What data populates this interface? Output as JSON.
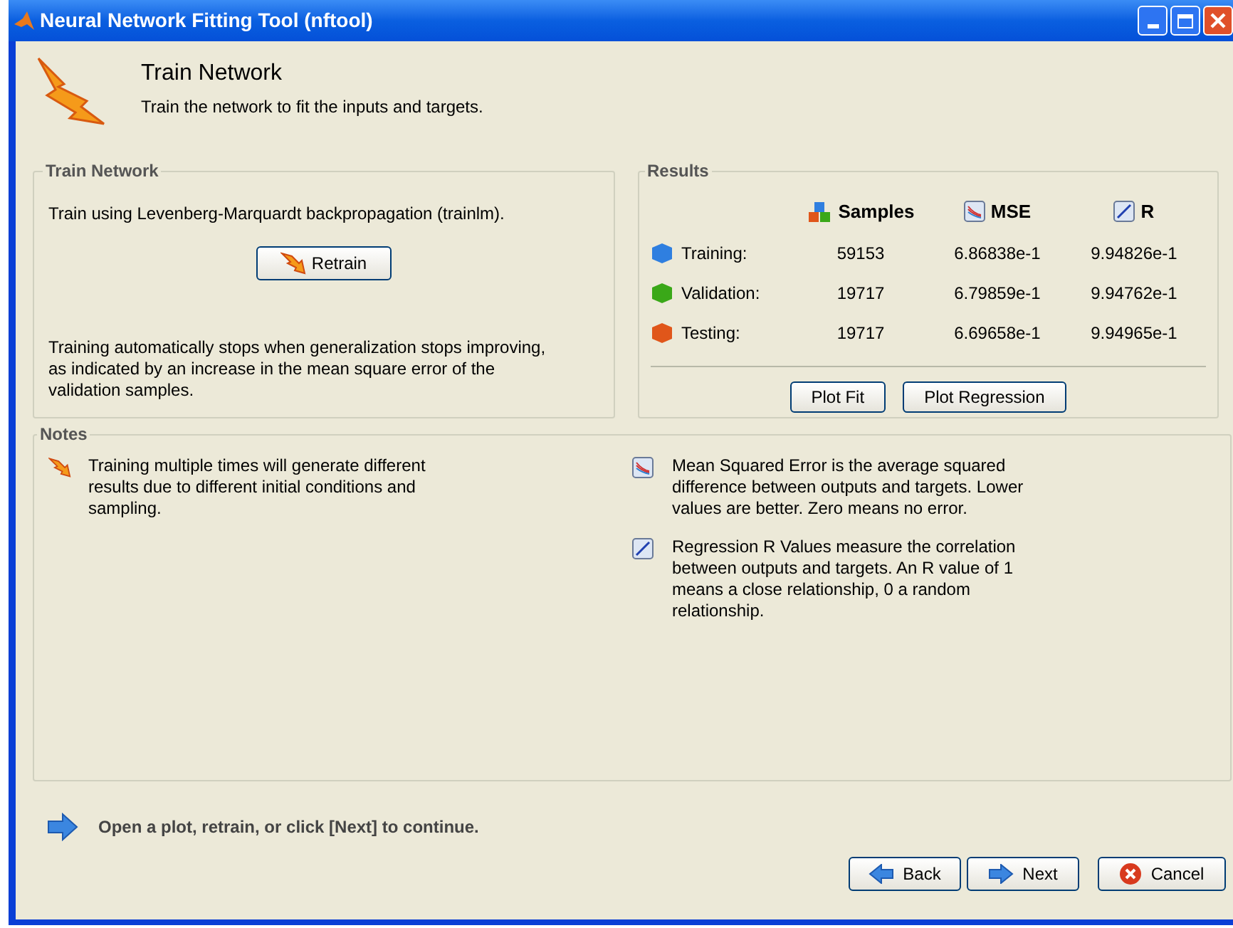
{
  "window": {
    "title": "Neural Network Fitting Tool (nftool)"
  },
  "header": {
    "title": "Train Network",
    "subtitle": "Train the network to fit the inputs and targets."
  },
  "train_panel": {
    "title": "Train Network",
    "description": "Train using Levenberg-Marquardt backpropagation (trainlm).",
    "button": "Retrain",
    "note": "Training automatically stops when generalization stops improving, as indicated by an increase in the mean square error of the validation samples."
  },
  "results": {
    "title": "Results",
    "columns": [
      {
        "label": "Samples",
        "kind": "samples"
      },
      {
        "label": "MSE",
        "kind": "mse"
      },
      {
        "label": "R",
        "kind": "r"
      }
    ],
    "rows": [
      {
        "label": "Training:",
        "color": "#2f7fe0",
        "samples": "59153",
        "mse": "6.86838e-1",
        "r": "9.94826e-1"
      },
      {
        "label": "Validation:",
        "color": "#3aa818",
        "samples": "19717",
        "mse": "6.79859e-1",
        "r": "9.94762e-1"
      },
      {
        "label": "Testing:",
        "color": "#e0561a",
        "samples": "19717",
        "mse": "6.69658e-1",
        "r": "9.94965e-1"
      }
    ],
    "buttons": [
      "Plot Fit",
      "Plot Regression"
    ]
  },
  "notes": {
    "title": "Notes",
    "items": [
      {
        "kind": "retrain",
        "text": "Training multiple times will generate different results due to different initial conditions and sampling."
      },
      {
        "kind": "mse",
        "text": "Mean Squared Error is the average squared difference between outputs and targets. Lower values are better. Zero means no error."
      },
      {
        "kind": "r",
        "text": "Regression R Values measure the correlation between outputs and targets. An R value of 1 means a close relationship, 0 a random relationship."
      }
    ]
  },
  "hint": "Open a plot, retrain, or click [Next] to continue.",
  "buttons": [
    {
      "kind": "back",
      "label": "Back"
    },
    {
      "kind": "next",
      "label": "Next"
    },
    {
      "kind": "cancel",
      "label": "Cancel"
    }
  ]
}
